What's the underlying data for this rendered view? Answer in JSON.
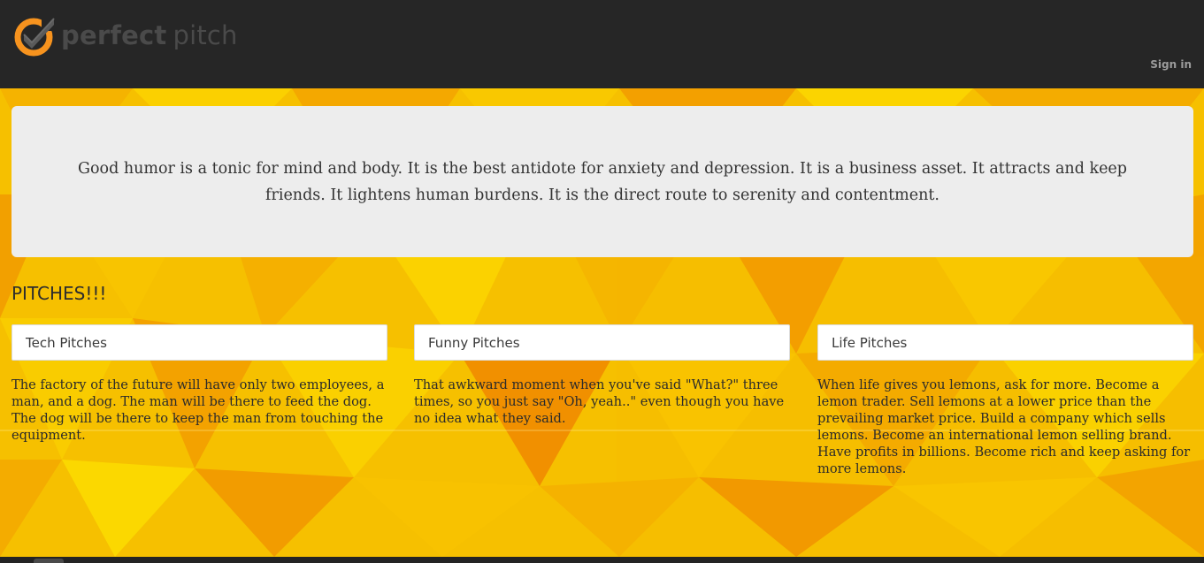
{
  "navbar": {
    "brand_bold": "perfect",
    "brand_light": "pitch",
    "signin_label": "Sign in"
  },
  "jumbotron": {
    "quote": "Good humor is a tonic for mind and body. It is the best antidote for anxiety and depression. It is a business asset. It attracts and keep friends. It lightens human burdens. It is the direct route to serenity and contentment."
  },
  "pitches": {
    "title": "PITCHES!!!",
    "categories": [
      {
        "label": "Tech Pitches",
        "text": "The factory of the future will have only two employees, a man, and a dog. The man will be there to feed the dog. The dog will be there to keep the man from touching the equipment."
      },
      {
        "label": "Funny Pitches",
        "text": "That awkward moment when you've said \"What?\" three times, so you just say \"Oh, yeah..\" even though you have no idea what they said."
      },
      {
        "label": "Life Pitches",
        "text": "When life gives you lemons, ask for more. Become a lemon trader. Sell lemons at a lower price than the prevailing market price. Build a company which sells lemons. Become an international lemon selling brand. Have profits in billions. Become rich and keep asking for more lemons."
      }
    ]
  },
  "colors": {
    "navbar": "#262626",
    "logo_orange": "#f7931e",
    "background_yellow": "#f6c400",
    "background_orange": "#f29100",
    "panel": "#ededed"
  },
  "icons": {
    "logo": "checkmark-circle-logo-icon"
  }
}
